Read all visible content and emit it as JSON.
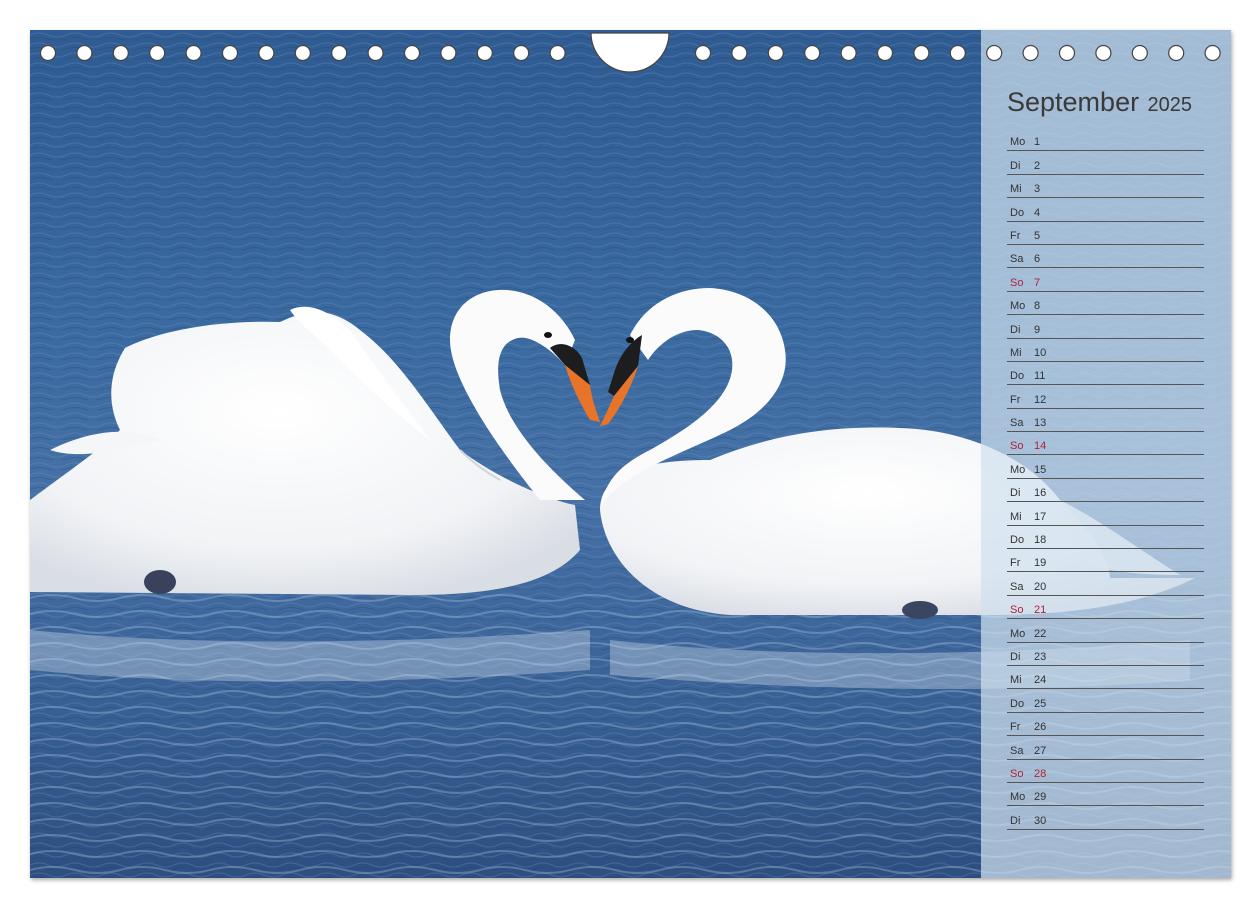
{
  "calendar": {
    "month": "September",
    "year": "2025",
    "days": [
      {
        "weekday": "Mo",
        "day": "1"
      },
      {
        "weekday": "Di",
        "day": "2"
      },
      {
        "weekday": "Mi",
        "day": "3"
      },
      {
        "weekday": "Do",
        "day": "4"
      },
      {
        "weekday": "Fr",
        "day": "5"
      },
      {
        "weekday": "Sa",
        "day": "6"
      },
      {
        "weekday": "So",
        "day": "7"
      },
      {
        "weekday": "Mo",
        "day": "8"
      },
      {
        "weekday": "Di",
        "day": "9"
      },
      {
        "weekday": "Mi",
        "day": "10"
      },
      {
        "weekday": "Do",
        "day": "11"
      },
      {
        "weekday": "Fr",
        "day": "12"
      },
      {
        "weekday": "Sa",
        "day": "13"
      },
      {
        "weekday": "So",
        "day": "14"
      },
      {
        "weekday": "Mo",
        "day": "15"
      },
      {
        "weekday": "Di",
        "day": "16"
      },
      {
        "weekday": "Mi",
        "day": "17"
      },
      {
        "weekday": "Do",
        "day": "18"
      },
      {
        "weekday": "Fr",
        "day": "19"
      },
      {
        "weekday": "Sa",
        "day": "20"
      },
      {
        "weekday": "So",
        "day": "21"
      },
      {
        "weekday": "Mo",
        "day": "22"
      },
      {
        "weekday": "Di",
        "day": "23"
      },
      {
        "weekday": "Mi",
        "day": "24"
      },
      {
        "weekday": "Do",
        "day": "25"
      },
      {
        "weekday": "Fr",
        "day": "26"
      },
      {
        "weekday": "Sa",
        "day": "27"
      },
      {
        "weekday": "So",
        "day": "28"
      },
      {
        "weekday": "Mo",
        "day": "29"
      },
      {
        "weekday": "Di",
        "day": "30"
      }
    ]
  },
  "colors": {
    "water": "#3d6193",
    "panel": "#d0e0ee",
    "sunday": "#b2203a",
    "text": "#333333"
  }
}
